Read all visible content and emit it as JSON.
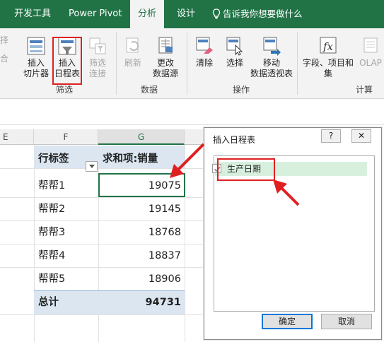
{
  "tabs": {
    "developer": "开发工具",
    "power_pivot": "Power Pivot",
    "analyze": "分析",
    "design": "设计",
    "tell_me": "告诉我你想要做什么"
  },
  "ribbon": {
    "left_edge_1": "择",
    "left_edge_2": "合",
    "insert_slicer": [
      "插入",
      "切片器"
    ],
    "insert_timeline": [
      "插入",
      "日程表"
    ],
    "filter_connections": [
      "筛选",
      "连接"
    ],
    "refresh": "刷新",
    "change_source": [
      "更改",
      "数据源"
    ],
    "clear": "清除",
    "select": "选择",
    "move_pivot": [
      "移动",
      "数据透视表"
    ],
    "fields_items": [
      "字段、项目和",
      "集"
    ],
    "olap": "OLAP",
    "groups": {
      "filter": "筛选",
      "data": "数据",
      "actions": "操作",
      "calculations": "计算"
    }
  },
  "grid": {
    "columns": [
      "E",
      "F",
      "G"
    ],
    "header": {
      "row_label": "行标签",
      "value_label": "求和项:销量"
    },
    "rows": [
      {
        "label": "帮帮1",
        "value": "19075"
      },
      {
        "label": "帮帮2",
        "value": "19145"
      },
      {
        "label": "帮帮3",
        "value": "18768"
      },
      {
        "label": "帮帮4",
        "value": "18837"
      },
      {
        "label": "帮帮5",
        "value": "18906"
      }
    ],
    "total": {
      "label": "总计",
      "value": "94731"
    }
  },
  "dialog": {
    "title": "插入日程表",
    "help": "?",
    "close": "✕",
    "field": {
      "label": "生产日期",
      "checked": true
    },
    "ok": "确定",
    "cancel": "取消"
  },
  "colors": {
    "excel_green": "#217346",
    "highlight_red": "#e02020",
    "pivot_band": "#dce6f1",
    "list_selected": "#d7f0de"
  }
}
